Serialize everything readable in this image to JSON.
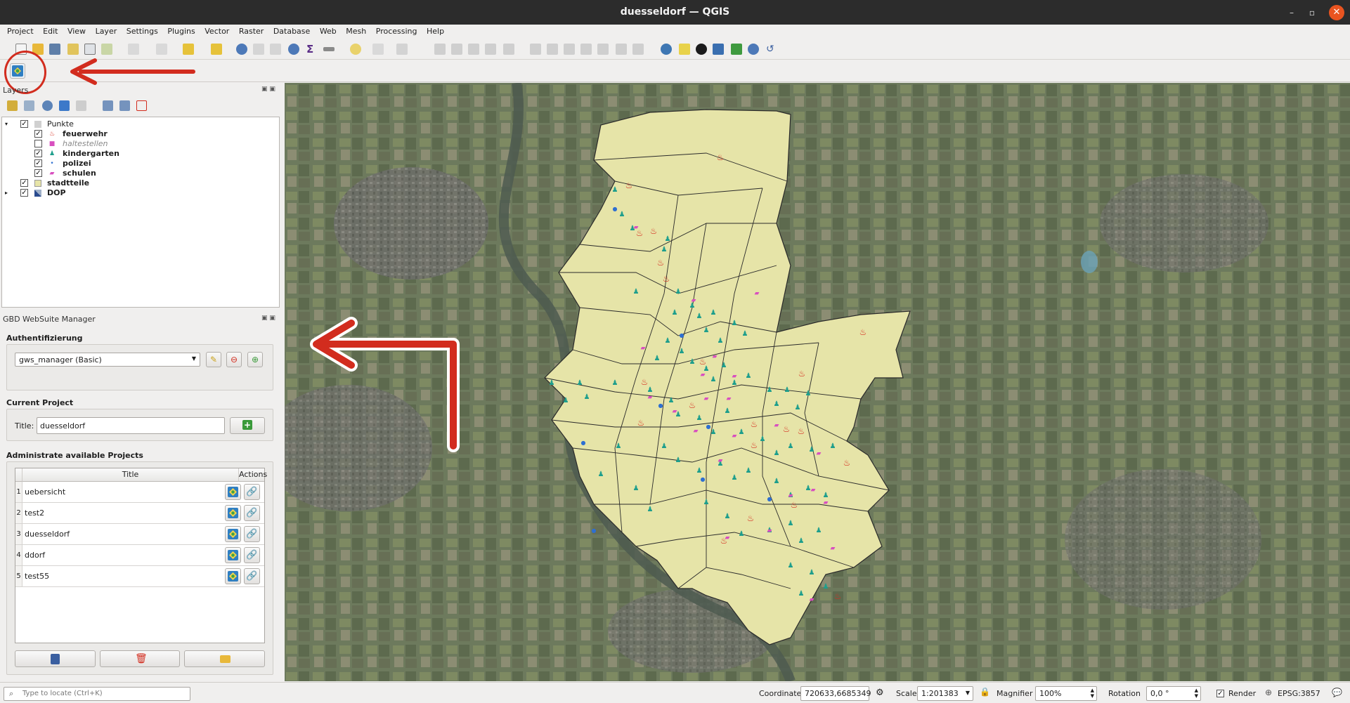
{
  "window": {
    "title": "duesseldorf — QGIS",
    "controls": [
      "–",
      "▫",
      "✕"
    ]
  },
  "menu": [
    "Project",
    "Edit",
    "View",
    "Layer",
    "Settings",
    "Plugins",
    "Vector",
    "Raster",
    "Database",
    "Web",
    "Mesh",
    "Processing",
    "Help"
  ],
  "layers_panel": {
    "title": "Layers",
    "tree": [
      {
        "name": "Punkte",
        "type": "group",
        "checked": true,
        "expanded": true
      },
      {
        "name": "feuerwehr",
        "checked": true,
        "style": "bold",
        "symbol": "fire-icon",
        "color": "#d62d20"
      },
      {
        "name": "haltestellen",
        "checked": false,
        "style": "italic",
        "symbol": "bus-icon",
        "color": "#d84fbf"
      },
      {
        "name": "kindergarten",
        "checked": true,
        "style": "bold",
        "symbol": "child-icon",
        "color": "#1e9e8c"
      },
      {
        "name": "polizei",
        "checked": true,
        "style": "bold",
        "symbol": "police-icon",
        "color": "#2e6fd1"
      },
      {
        "name": "schulen",
        "checked": true,
        "style": "bold",
        "symbol": "school-icon",
        "color": "#d84fbf"
      },
      {
        "name": "stadtteile",
        "checked": true,
        "style": "bold",
        "symbol": "polygon-swatch",
        "color": "#e6e4a8"
      },
      {
        "name": "DOP",
        "checked": true,
        "style": "bold",
        "symbol": "raster-icon",
        "color": "#2a4b8f"
      }
    ]
  },
  "gws_panel": {
    "title": "GBD WebSuite Manager",
    "auth_heading": "Authentifizierung",
    "auth_selected": "gws_manager (Basic)",
    "current_project_heading": "Current Project",
    "title_label": "Title:",
    "title_value": "duesseldorf",
    "admin_heading": "Administrate available Projects",
    "table": {
      "columns": [
        "Title",
        "Actions"
      ],
      "rows": [
        {
          "n": "1",
          "title": "uebersicht"
        },
        {
          "n": "2",
          "title": "test2"
        },
        {
          "n": "3",
          "title": "duesseldorf"
        },
        {
          "n": "4",
          "title": "ddorf"
        },
        {
          "n": "5",
          "title": "test55"
        }
      ]
    }
  },
  "statusbar": {
    "locate_placeholder": "Type to locate (Ctrl+K)",
    "coordinate_label": "Coordinate",
    "coordinate_value": "720633,6685349",
    "scale_label": "Scale",
    "scale_value": "1:201383",
    "magnifier_label": "Magnifier",
    "magnifier_value": "100%",
    "rotation_label": "Rotation",
    "rotation_value": "0,0 °",
    "render_label": "Render",
    "render_checked": true,
    "crs": "EPSG:3857"
  },
  "colors": {
    "accent_red": "#d22c1e",
    "polygon_fill": "#e6e4a8",
    "ubuntu_close": "#e95420"
  }
}
